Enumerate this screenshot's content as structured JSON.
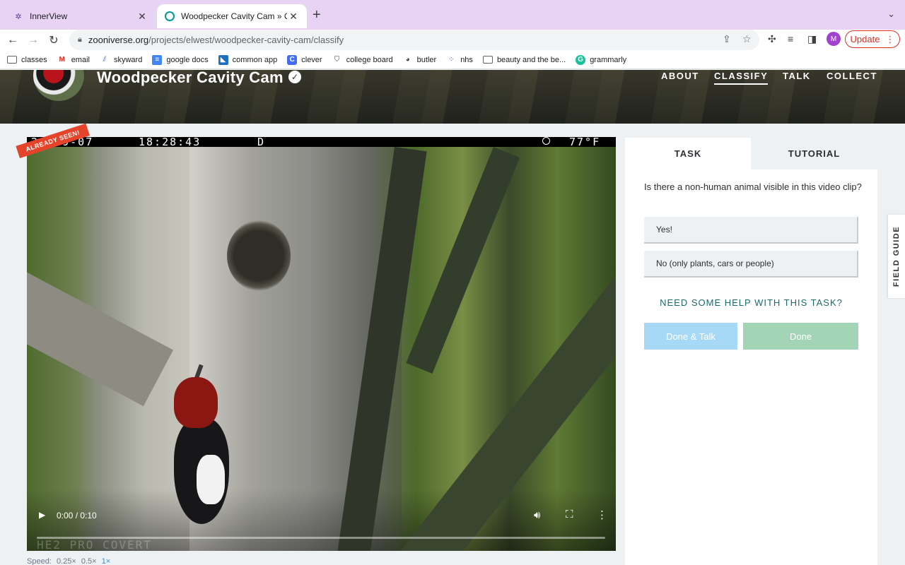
{
  "browser": {
    "tabs": [
      {
        "title": "InnerView",
        "favicon": "innerview-icon",
        "active": false
      },
      {
        "title": "Woodpecker Cavity Cam » Cla",
        "favicon": "zooniverse-icon",
        "active": true
      }
    ],
    "address": {
      "host": "zooniverse.org",
      "path": "/projects/elwest/woodpecker-cavity-cam/classify"
    },
    "profile_initial": "M",
    "update_label": "Update",
    "bookmarks": [
      {
        "label": "classes",
        "icon": "folder-icon"
      },
      {
        "label": "email",
        "icon": "gmail-icon"
      },
      {
        "label": "skyward",
        "icon": "skyward-icon"
      },
      {
        "label": "google docs",
        "icon": "google-docs-icon"
      },
      {
        "label": "common app",
        "icon": "common-app-icon"
      },
      {
        "label": "clever",
        "icon": "clever-icon"
      },
      {
        "label": "college board",
        "icon": "college-board-icon"
      },
      {
        "label": "butler",
        "icon": "butler-icon"
      },
      {
        "label": "nhs",
        "icon": "nhs-icon"
      },
      {
        "label": "beauty and the be...",
        "icon": "folder-icon"
      },
      {
        "label": "grammarly",
        "icon": "grammarly-icon"
      }
    ]
  },
  "project": {
    "title": "Woodpecker Cavity Cam",
    "nav": [
      "ABOUT",
      "CLASSIFY",
      "TALK",
      "COLLECT"
    ],
    "active_nav": "CLASSIFY"
  },
  "video": {
    "osd_date": "20  09-07",
    "osd_time": "18:28:43",
    "osd_flag": "D",
    "osd_temp": "77°F",
    "osd_bottom": "HE2 PRO COVERT",
    "time_display": "0:00 / 0:10",
    "progress": 0,
    "badge": "ALREADY SEEN!",
    "speed_label": "Speed:",
    "speed_options": [
      "0.25×",
      "0.5×",
      "1×"
    ],
    "current_speed": "1×"
  },
  "task_panel": {
    "tabs": [
      "TASK",
      "TUTORIAL"
    ],
    "question": "Is there a non-human animal visible in this video clip?",
    "answers": [
      "Yes!",
      "No (only plants, cars or people)"
    ],
    "help": "NEED SOME HELP WITH THIS TASK?",
    "done_talk": "Done & Talk",
    "done": "Done",
    "field_guide": "FIELD GUIDE"
  },
  "colors": {
    "accent_badge": "#e5432a",
    "done_talk": "#a7d9f7",
    "done": "#a3d4b6",
    "help_link": "#1a6a6a",
    "update": "#d93025"
  }
}
